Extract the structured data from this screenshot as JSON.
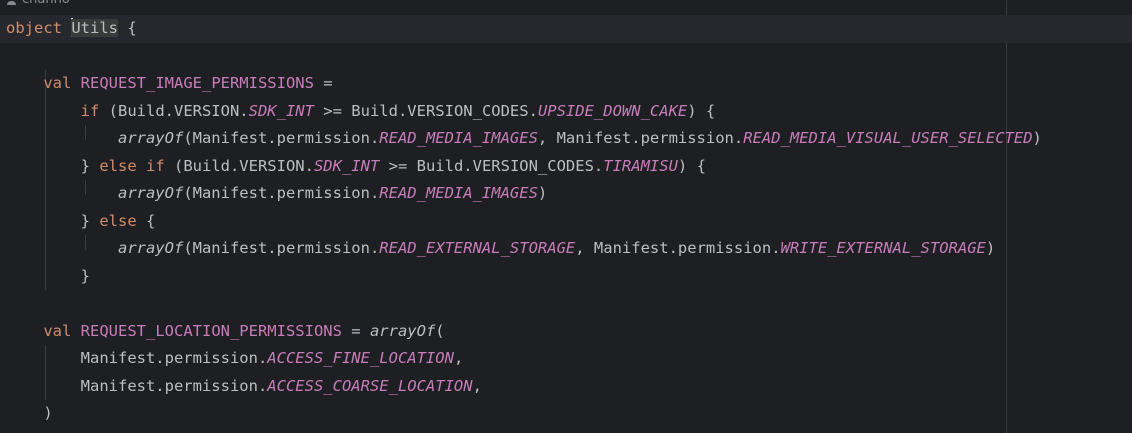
{
  "editor": {
    "author_hint": "channo",
    "lines": [
      [
        {
          "t": "object",
          "c": "kw"
        },
        {
          "t": " ",
          "c": "plain"
        },
        {
          "t": "Utils",
          "c": "plain",
          "caret": true,
          "highlight": true
        },
        {
          "t": " {",
          "c": "plain"
        }
      ],
      [],
      [
        {
          "t": "    ",
          "c": "plain"
        },
        {
          "t": "val",
          "c": "kw"
        },
        {
          "t": " ",
          "c": "plain"
        },
        {
          "t": "REQUEST_IMAGE_PERMISSIONS",
          "c": "decl"
        },
        {
          "t": " =",
          "c": "plain"
        }
      ],
      [
        {
          "t": "        ",
          "c": "plain"
        },
        {
          "t": "if",
          "c": "kw"
        },
        {
          "t": " (Build.VERSION.",
          "c": "plain"
        },
        {
          "t": "SDK_INT",
          "c": "field"
        },
        {
          "t": " >= Build.VERSION_CODES.",
          "c": "plain"
        },
        {
          "t": "UPSIDE_DOWN_CAKE",
          "c": "field"
        },
        {
          "t": ") {",
          "c": "plain"
        }
      ],
      [
        {
          "t": "            ",
          "c": "plain"
        },
        {
          "t": "arrayOf",
          "c": "fn"
        },
        {
          "t": "(Manifest.permission.",
          "c": "plain"
        },
        {
          "t": "READ_MEDIA_IMAGES",
          "c": "field"
        },
        {
          "t": ", Manifest.permission.",
          "c": "plain"
        },
        {
          "t": "READ_MEDIA_VISUAL_USER_SELECTED",
          "c": "field"
        },
        {
          "t": ")",
          "c": "plain"
        }
      ],
      [
        {
          "t": "        } ",
          "c": "plain"
        },
        {
          "t": "else if",
          "c": "kw"
        },
        {
          "t": " (Build.VERSION.",
          "c": "plain"
        },
        {
          "t": "SDK_INT",
          "c": "field"
        },
        {
          "t": " >= Build.VERSION_CODES.",
          "c": "plain"
        },
        {
          "t": "TIRAMISU",
          "c": "field"
        },
        {
          "t": ") {",
          "c": "plain"
        }
      ],
      [
        {
          "t": "            ",
          "c": "plain"
        },
        {
          "t": "arrayOf",
          "c": "fn"
        },
        {
          "t": "(Manifest.permission.",
          "c": "plain"
        },
        {
          "t": "READ_MEDIA_IMAGES",
          "c": "field"
        },
        {
          "t": ")",
          "c": "plain"
        }
      ],
      [
        {
          "t": "        } ",
          "c": "plain"
        },
        {
          "t": "else",
          "c": "kw"
        },
        {
          "t": " {",
          "c": "plain"
        }
      ],
      [
        {
          "t": "            ",
          "c": "plain"
        },
        {
          "t": "arrayOf",
          "c": "fn"
        },
        {
          "t": "(Manifest.permission.",
          "c": "plain"
        },
        {
          "t": "READ_EXTERNAL_STORAGE",
          "c": "field"
        },
        {
          "t": ", Manifest.permission.",
          "c": "plain"
        },
        {
          "t": "WRITE_EXTERNAL_STORAGE",
          "c": "field"
        },
        {
          "t": ")",
          "c": "plain"
        }
      ],
      [
        {
          "t": "        }",
          "c": "plain"
        }
      ],
      [],
      [
        {
          "t": "    ",
          "c": "plain"
        },
        {
          "t": "val",
          "c": "kw"
        },
        {
          "t": " ",
          "c": "plain"
        },
        {
          "t": "REQUEST_LOCATION_PERMISSIONS",
          "c": "decl"
        },
        {
          "t": " = ",
          "c": "plain"
        },
        {
          "t": "arrayOf",
          "c": "fn"
        },
        {
          "t": "(",
          "c": "plain"
        }
      ],
      [
        {
          "t": "        Manifest.permission.",
          "c": "plain"
        },
        {
          "t": "ACCESS_FINE_LOCATION",
          "c": "field"
        },
        {
          "t": ",",
          "c": "plain"
        }
      ],
      [
        {
          "t": "        Manifest.permission.",
          "c": "plain"
        },
        {
          "t": "ACCESS_COARSE_LOCATION",
          "c": "field"
        },
        {
          "t": ",",
          "c": "plain"
        }
      ],
      [
        {
          "t": "    )",
          "c": "plain"
        }
      ]
    ]
  },
  "colors": {
    "background": "#1e1f22",
    "current_line": "#26282e",
    "keyword": "#cf8e6d",
    "constant": "#c77dbb",
    "text": "#bcbec4",
    "indent_guide": "#393b40"
  }
}
